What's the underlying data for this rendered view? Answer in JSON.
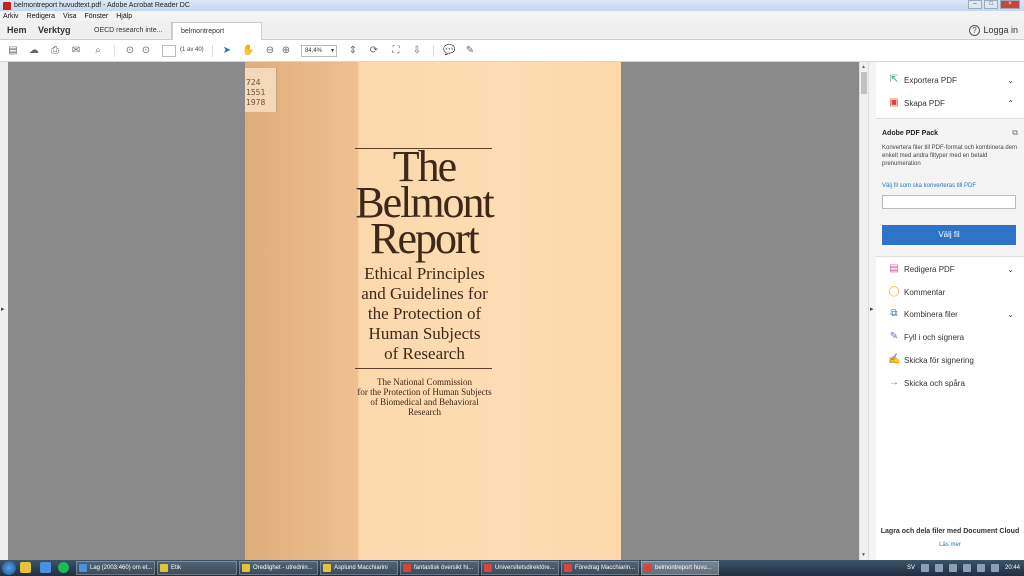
{
  "window": {
    "title": "belmontreport huvudtext.pdf - Adobe Acrobat Reader DC"
  },
  "menu": [
    "Arkiv",
    "Redigera",
    "Visa",
    "Fönster",
    "Hjälp"
  ],
  "nav": {
    "home": "Hem",
    "tools": "Verktyg"
  },
  "tabs": [
    {
      "label": "OECD research inte..."
    },
    {
      "label": "belmontreport huv...",
      "close": "×"
    }
  ],
  "header": {
    "help": "?",
    "login": "Logga in"
  },
  "toolbar": {
    "page_count": "(1 av 40)",
    "zoom": "84,4%"
  },
  "document": {
    "call_number": "724\n1551\n1978",
    "title_lines": [
      "The",
      "Belmont",
      "Report"
    ],
    "subtitle_lines": [
      "Ethical Principles",
      "and Guidelines for",
      "the Protection of",
      "Human Subjects",
      "of Research"
    ],
    "org_lines": [
      "The National Commission",
      "for the Protection of Human Subjects",
      "of Biomedical and Behavioral",
      "Research"
    ]
  },
  "right_panel": {
    "items_top": [
      {
        "label": "Exportera PDF",
        "icon": "export-pdf-icon",
        "chevron": "⌄",
        "color": "#27a17a"
      },
      {
        "label": "Skapa PDF",
        "icon": "create-pdf-icon",
        "chevron": "⌃",
        "color": "#d6453a"
      }
    ],
    "pack": {
      "heading": "Adobe PDF Pack",
      "description": "Konvertera filer till PDF-format och kombinera dem enkelt med andra filtyper med en betald prenumeration",
      "link": "Välj fil som ska konverteras till PDF",
      "button": "Välj fil"
    },
    "items_bottom": [
      {
        "label": "Redigera PDF",
        "icon": "edit-pdf-icon",
        "chevron": "⌄",
        "color": "#d64f9a"
      },
      {
        "label": "Kommentar",
        "icon": "comment-icon",
        "chevron": "",
        "color": "#e8b923"
      },
      {
        "label": "Kombinera filer",
        "icon": "combine-files-icon",
        "chevron": "⌄",
        "color": "#2d73c6"
      },
      {
        "label": "Fyll i och signera",
        "icon": "fill-sign-icon",
        "chevron": "",
        "color": "#7b5fc7"
      },
      {
        "label": "Skicka för signering",
        "icon": "send-for-signature-icon",
        "chevron": "",
        "color": "#7b5fc7"
      },
      {
        "label": "Skicka och spåra",
        "icon": "send-track-icon",
        "chevron": "",
        "color": "#2d9ad6"
      }
    ],
    "footer": "Lagra och dela filer med Document Cloud",
    "footer_link": "Läs mer"
  },
  "taskbar": {
    "buttons": [
      {
        "label": "Lag (2003:460) om et...",
        "color": "#4a90e2"
      },
      {
        "label": "Etik",
        "color": "#e6c23a"
      },
      {
        "label": "Oredlighet - utrednin...",
        "color": "#e6c23a"
      },
      {
        "label": "Asplund Macchiarini",
        "color": "#e6c23a"
      },
      {
        "label": "fantastisk översikt hi...",
        "color": "#d6453a"
      },
      {
        "label": "Universitetsdirektöre...",
        "color": "#d6453a"
      },
      {
        "label": "Föredrag Macchiarin...",
        "color": "#d6453a"
      },
      {
        "label": "belmontreport huvu...",
        "color": "#d6453a"
      }
    ],
    "lang": "SV",
    "time": "20:44"
  }
}
